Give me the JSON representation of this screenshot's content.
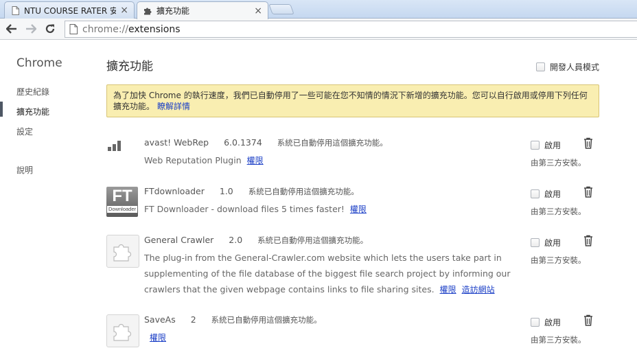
{
  "tabs": [
    {
      "title": "NTU COURSE RATER 安装",
      "close": "×",
      "icon": "page-icon"
    },
    {
      "title": "擴充功能",
      "close": "×",
      "icon": "puzzle-icon"
    }
  ],
  "omnibox": {
    "scheme": "chrome://",
    "host": "extensions"
  },
  "sidebar": {
    "brand": "Chrome",
    "items": [
      {
        "label": "歷史紀錄"
      },
      {
        "label": "擴充功能"
      },
      {
        "label": "設定"
      },
      {
        "label": "說明"
      }
    ]
  },
  "main": {
    "title": "擴充功能",
    "devmode_label": "開發人員模式",
    "alert_text": "為了加快 Chrome 的執行速度，我們已自動停用了一些可能在您不知情的情況下新增的擴充功能。您可以自行啟用或停用下列任何擴充功能。",
    "alert_link": "瞭解詳情"
  },
  "extensions": [
    {
      "name": "avast! WebRep",
      "version": "6.0.1374",
      "status": "系統已自動停用這個擴充功能。",
      "description": "Web Reputation Plugin",
      "permissions_link": "權限",
      "enable_label": "啟用",
      "installed_by": "由第三方安裝。",
      "icon": "avast-bars-icon"
    },
    {
      "name": "FTdownloader",
      "version": "1.0",
      "status": "系統已自動停用這個擴充功能。",
      "description": "FT Downloader - download files 5 times faster!",
      "permissions_link": "權限",
      "enable_label": "啟用",
      "installed_by": "由第三方安裝。",
      "icon_text_big": "FT",
      "icon_text_small": "Downloader"
    },
    {
      "name": "General Crawler",
      "version": "2.0",
      "status": "系統已自動停用這個擴充功能。",
      "description": "The plug-in from the General-Crawler.com website which lets the users take part in supplementing of the file database of the biggest file search project by informing our crawlers that the given webpage contains links to file sharing sites.",
      "permissions_link": "權限",
      "visit_link": "造訪網站",
      "enable_label": "啟用",
      "installed_by": "由第三方安裝。",
      "icon": "puzzle-icon"
    },
    {
      "name": "SaveAs",
      "version": "2",
      "status": "系統已自動停用這個擴充功能。",
      "permissions_link": "權限",
      "enable_label": "啟用",
      "installed_by": "由第三方安裝。",
      "icon": "puzzle-icon"
    }
  ]
}
